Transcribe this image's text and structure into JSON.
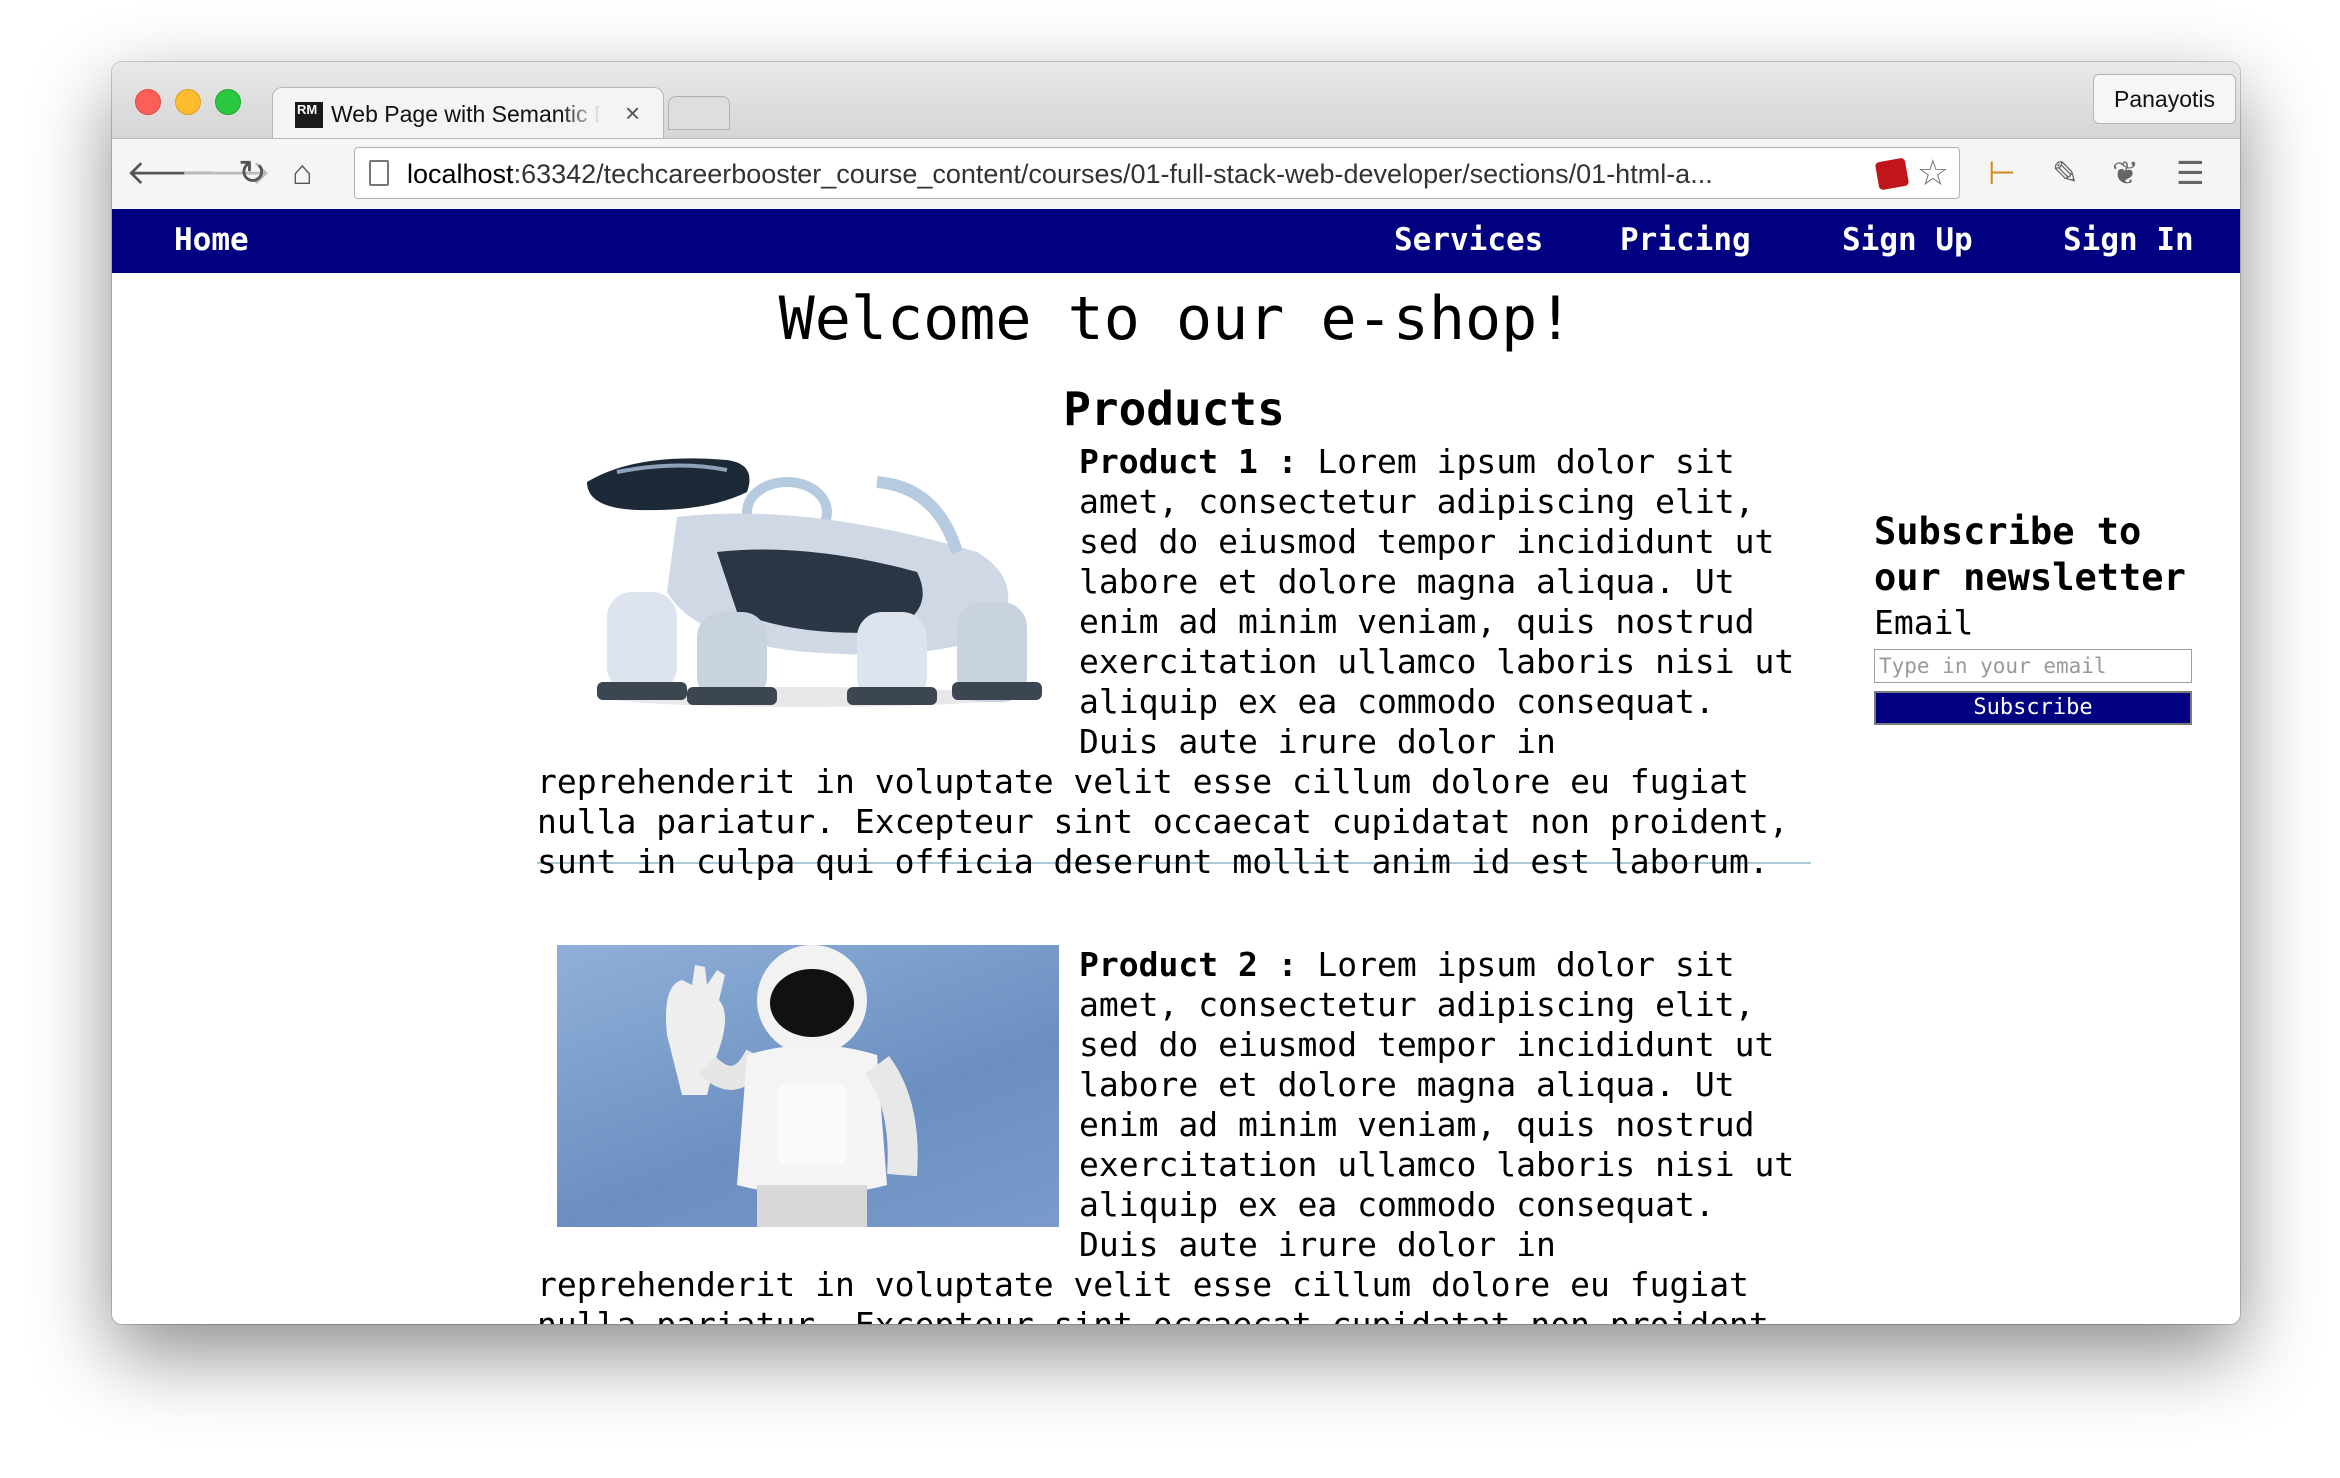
{
  "browser": {
    "tab_title": "Web Page with Semantic E",
    "tab_favicon": "RM",
    "profile_name": "Panayotis",
    "url_host": "localhost",
    "url_path": ":63342/techcareerbooster_course_content/courses/01-full-stack-web-developer/sections/01-html-a..."
  },
  "site_nav": {
    "home": "Home",
    "services": "Services",
    "pricing": "Pricing",
    "sign_up": "Sign Up",
    "sign_in": "Sign In",
    "background_color": "#000080"
  },
  "main": {
    "headline": "Welcome to our e-shop!",
    "products_title": "Products",
    "products": [
      {
        "name": "Product 1 :",
        "image": "robot-dog-image",
        "description": " Lorem ipsum dolor sit amet, consectetur adipiscing elit, sed do eiusmod tempor incididunt ut labore et dolore magna aliqua. Ut enim ad minim veniam, quis nostrud exercitation ullamco laboris nisi ut aliquip ex ea commodo consequat. Duis aute irure dolor in reprehenderit in voluptate velit esse cillum dolore eu fugiat nulla pariatur. Excepteur sint occaecat cupidatat non proident, sunt in culpa qui officia deserunt mollit anim id est laborum."
      },
      {
        "name": "Product 2 :",
        "image": "humanoid-robot-image",
        "description": " Lorem ipsum dolor sit amet, consectetur adipiscing elit, sed do eiusmod tempor incididunt ut labore et dolore magna aliqua. Ut enim ad minim veniam, quis nostrud exercitation ullamco laboris nisi ut aliquip ex ea commodo consequat. Duis aute irure dolor in reprehenderit in voluptate velit esse cillum dolore eu fugiat nulla pariatur. Excepteur sint occaecat cupidatat non proident, sunt in culpa qui officia deserunt mollit anim id est laborum."
      }
    ]
  },
  "newsletter": {
    "title": "Subscribe to our newsletter",
    "email_label": "Email",
    "email_placeholder": "Type in your email",
    "email_value": "",
    "button_label": "Subscribe"
  }
}
